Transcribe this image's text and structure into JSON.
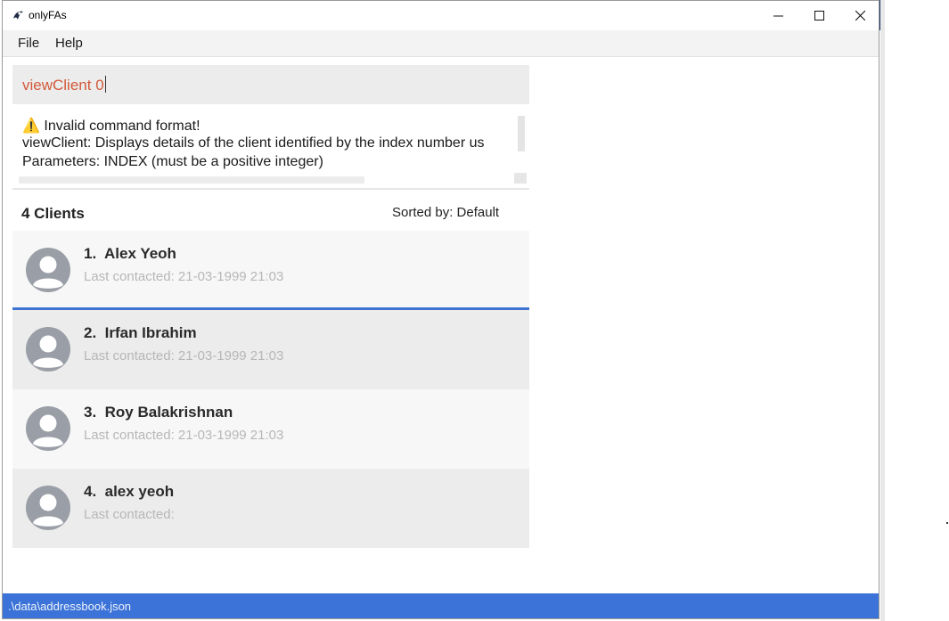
{
  "window": {
    "title": "onlyFAs",
    "controls": {
      "minimize": "minimize-icon",
      "maximize": "maximize-icon",
      "close": "close-icon"
    }
  },
  "menu": {
    "items": [
      "File",
      "Help"
    ]
  },
  "command_box": {
    "value": "viewClient 0"
  },
  "result_display": {
    "lines": [
      "⚠️ Invalid command format!",
      "viewClient: Displays details of the client identified by the index number us",
      "Parameters: INDEX (must be a positive integer)"
    ]
  },
  "client_list": {
    "count_label": "4 Clients",
    "sort_label": "Sorted by: Default",
    "clients": [
      {
        "name": "1.  Alex Yeoh",
        "contact": "Last contacted: 21-03-1999 21:03"
      },
      {
        "name": "2.  Irfan Ibrahim",
        "contact": "Last contacted: 21-03-1999 21:03"
      },
      {
        "name": "3.  Roy Balakrishnan",
        "contact": "Last contacted: 21-03-1999 21:03"
      },
      {
        "name": "4.  alex yeoh",
        "contact": "Last contacted:"
      }
    ]
  },
  "status_bar": {
    "path": ".\\data\\addressbook.json"
  },
  "colors": {
    "accent": "#3b73d8",
    "command_text": "#d2593b",
    "selected_border": "#3f73d1"
  }
}
